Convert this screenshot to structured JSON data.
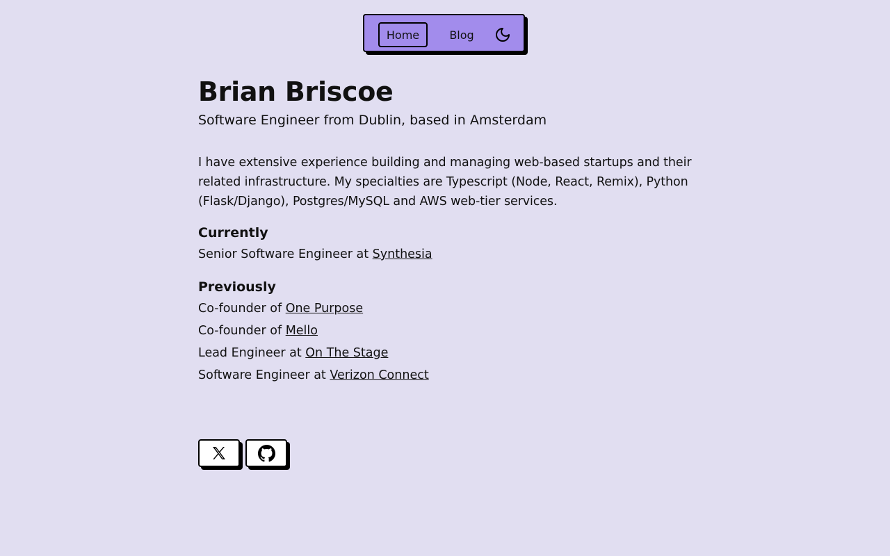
{
  "nav": {
    "home_label": "Home",
    "blog_label": "Blog",
    "theme_icon": "moon-icon"
  },
  "profile": {
    "name": "Brian Briscoe",
    "tagline": "Software Engineer from Dublin, based in Amsterdam",
    "bio": "I have extensive experience building and managing web-based startups and their related infrastructure. My specialties are Typescript (Node, React, Remix), Python (Flask/Django), Postgres/MySQL and AWS web-tier services."
  },
  "currently": {
    "title": "Currently",
    "items": [
      {
        "prefix": "Senior Software Engineer at ",
        "link": "Synthesia"
      }
    ]
  },
  "previously": {
    "title": "Previously",
    "items": [
      {
        "prefix": "Co-founder of ",
        "link": "One Purpose"
      },
      {
        "prefix": "Co-founder of ",
        "link": "Mello"
      },
      {
        "prefix": "Lead Engineer at ",
        "link": "On The Stage"
      },
      {
        "prefix": "Software Engineer at ",
        "link": "Verizon Connect"
      }
    ]
  },
  "socials": [
    {
      "icon": "x-logo-icon"
    },
    {
      "icon": "github-icon"
    }
  ],
  "colors": {
    "background": "#e1def1",
    "nav_accent": "#a28cec",
    "border": "#000000",
    "button_bg": "#ffffff"
  }
}
